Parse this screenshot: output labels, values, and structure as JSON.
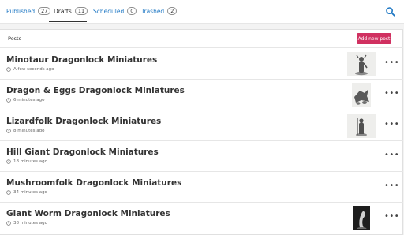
{
  "tabs": [
    {
      "label": "Published",
      "count": "27"
    },
    {
      "label": "Drafts",
      "count": "11"
    },
    {
      "label": "Scheduled",
      "count": "0"
    },
    {
      "label": "Trashed",
      "count": "2"
    }
  ],
  "panel": {
    "title": "Posts",
    "add_button": "Add new post"
  },
  "posts": [
    {
      "title": "Minotaur Dragonlock Miniatures",
      "time": "A few seconds ago"
    },
    {
      "title": "Dragon & Eggs Dragonlock Miniatures",
      "time": "6 minutes ago"
    },
    {
      "title": "Lizardfolk Dragonlock Miniatures",
      "time": "8 minutes ago"
    },
    {
      "title": "Hill Giant Dragonlock Miniatures",
      "time": "18 minutes ago"
    },
    {
      "title": "Mushroomfolk Dragonlock Miniatures",
      "time": "34 minutes ago"
    },
    {
      "title": "Giant Worm Dragonlock Miniatures",
      "time": "38 minutes ago"
    }
  ],
  "icons": {
    "search": "search-icon",
    "clock": "clock-icon",
    "more": "more-options-icon"
  },
  "colors": {
    "link": "#1f78c4",
    "accent": "#d03060"
  }
}
